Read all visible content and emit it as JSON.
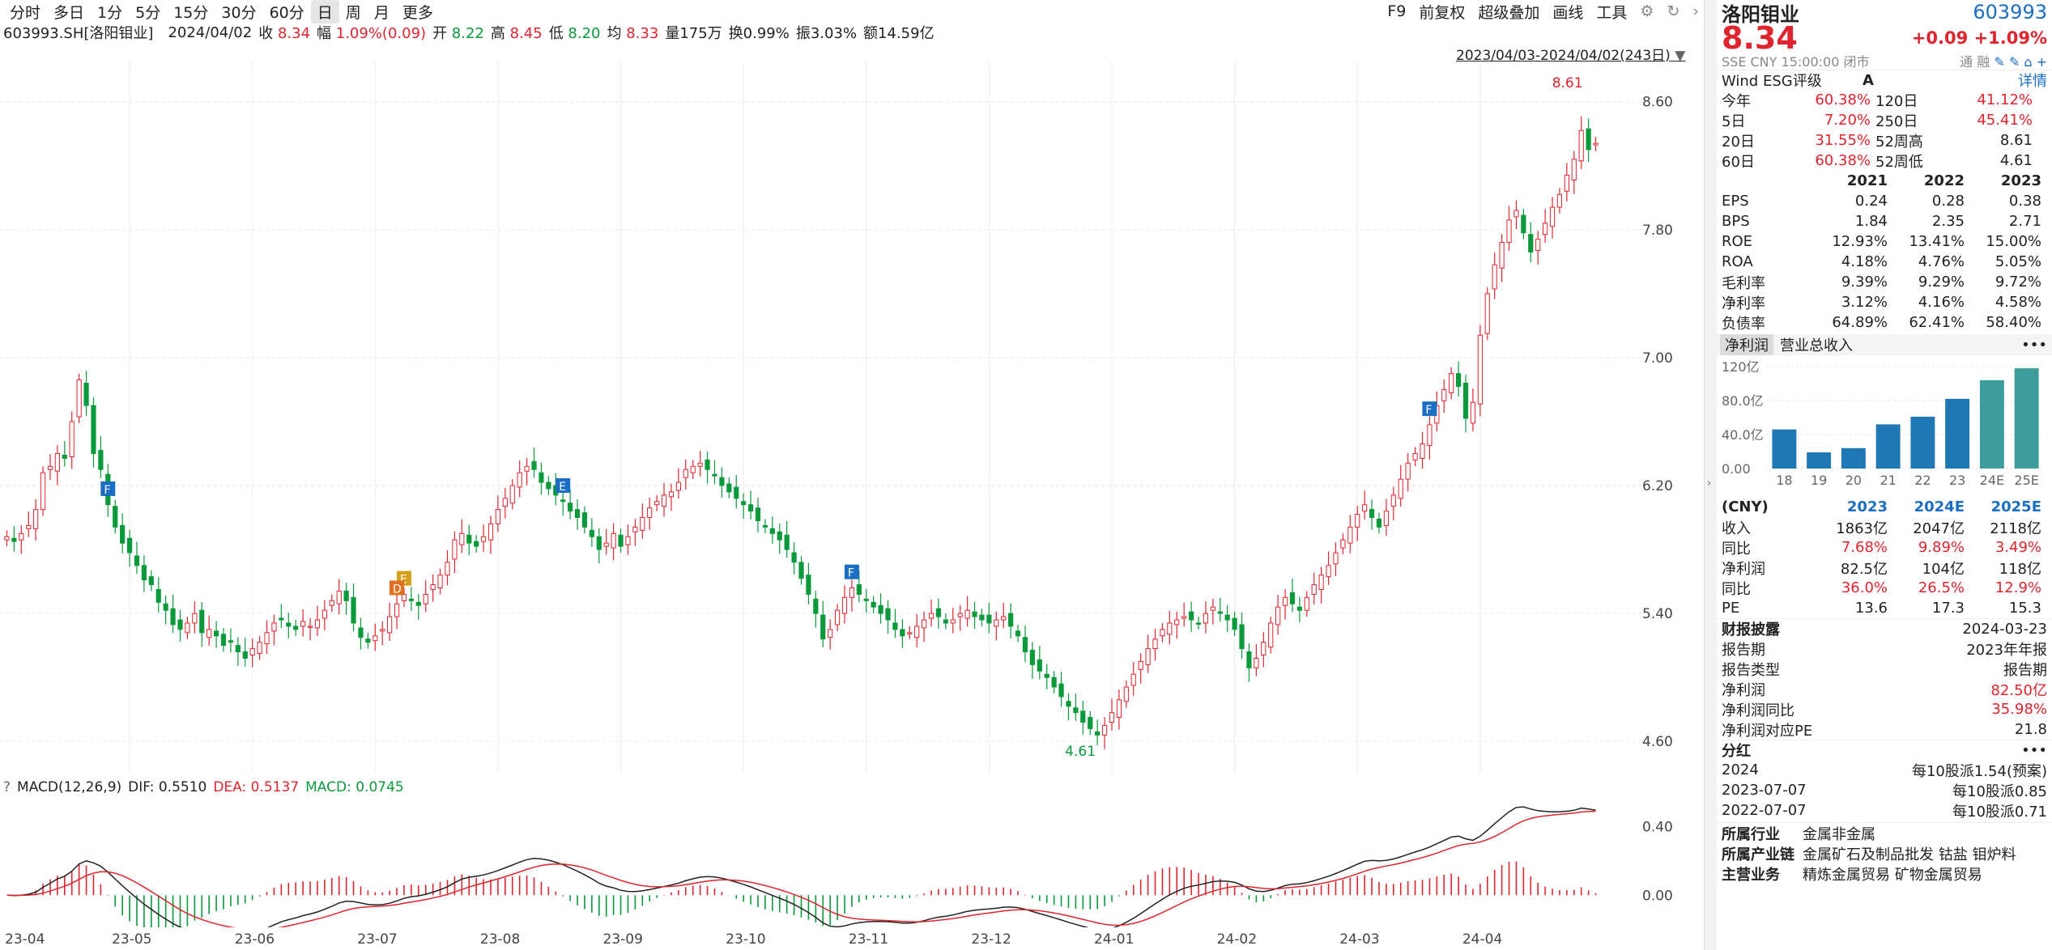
{
  "toolbar": {
    "tabs": [
      "分时",
      "多日",
      "1分",
      "5分",
      "15分",
      "30分",
      "60分",
      "日",
      "周",
      "月",
      "更多"
    ],
    "active": "日",
    "tools": [
      "F9",
      "前复权",
      "超级叠加",
      "画线",
      "工具"
    ]
  },
  "info": {
    "code": "603993.SH[洛阳钼业]",
    "date": "2024/04/02",
    "close_label": "收",
    "close": "8.34",
    "chg_label": "幅",
    "chg": "1.09%(0.09)",
    "open_label": "开",
    "open": "8.22",
    "high_label": "高",
    "high": "8.45",
    "low_label": "低",
    "low": "8.20",
    "avg_label": "均",
    "avg": "8.33",
    "vol_label": "量",
    "vol": "175万",
    "turn_label": "换",
    "turn": "0.99%",
    "amp_label": "振",
    "amp": "3.03%",
    "amt_label": "额",
    "amt": "14.59亿"
  },
  "range": "2023/04/03-2024/04/02(243日)",
  "macd": {
    "label": "MACD(12,26,9)",
    "dif_label": "DIF:",
    "dif": "0.5510",
    "dea_label": "DEA:",
    "dea": "0.5137",
    "macd_label": "MACD:",
    "macd": "0.0745"
  },
  "chart_data": [
    {
      "type": "candlestick",
      "y_ticks": [
        "8.60",
        "7.80",
        "7.00",
        "6.20",
        "5.40",
        "4.60"
      ],
      "ylim": [
        4.5,
        8.75
      ],
      "x_labels": [
        "23-04",
        "23-05",
        "23-06",
        "23-07",
        "23-08",
        "23-09",
        "23-10",
        "23-11",
        "23-12",
        "24-01",
        "24-02",
        "24-03",
        "24-04"
      ],
      "max_label": "8.61",
      "min_label": "4.61",
      "event_markers": [
        "F",
        "E",
        "D",
        "E",
        "F",
        "F"
      ],
      "close": [
        5.88,
        5.85,
        5.9,
        5.95,
        6.05,
        6.28,
        6.32,
        6.4,
        6.37,
        6.6,
        6.86,
        6.7,
        6.4,
        6.3,
        6.08,
        5.94,
        5.84,
        5.78,
        5.7,
        5.61,
        5.58,
        5.47,
        5.42,
        5.33,
        5.3,
        5.34,
        5.4,
        5.28,
        5.3,
        5.26,
        5.2,
        5.22,
        5.16,
        5.12,
        5.18,
        5.22,
        5.28,
        5.34,
        5.36,
        5.32,
        5.3,
        5.35,
        5.32,
        5.36,
        5.42,
        5.48,
        5.54,
        5.48,
        5.34,
        5.25,
        5.22,
        5.26,
        5.3,
        5.38,
        5.46,
        5.52,
        5.48,
        5.45,
        5.52,
        5.58,
        5.64,
        5.72,
        5.86,
        5.9,
        5.84,
        5.82,
        5.88,
        5.96,
        6.05,
        6.12,
        6.2,
        6.28,
        6.32,
        6.3,
        6.22,
        6.18,
        6.14,
        6.1,
        6.04,
        6.0,
        5.94,
        5.88,
        5.8,
        5.84,
        5.9,
        5.82,
        5.88,
        5.94,
        6.0,
        6.06,
        6.1,
        6.14,
        6.16,
        6.22,
        6.3,
        6.32,
        6.34,
        6.3,
        6.26,
        6.2,
        6.16,
        6.12,
        6.08,
        6.04,
        5.98,
        5.94,
        5.9,
        5.86,
        5.8,
        5.72,
        5.62,
        5.52,
        5.4,
        5.24,
        5.3,
        5.42,
        5.5,
        5.56,
        5.52,
        5.48,
        5.44,
        5.4,
        5.36,
        5.3,
        5.26,
        5.28,
        5.32,
        5.36,
        5.4,
        5.38,
        5.34,
        5.36,
        5.4,
        5.42,
        5.38,
        5.36,
        5.34,
        5.36,
        5.38,
        5.32,
        5.26,
        5.16,
        5.08,
        5.04,
        5.0,
        4.94,
        4.88,
        4.82,
        4.78,
        4.72,
        4.68,
        4.64,
        4.7,
        4.78,
        4.86,
        4.94,
        5.02,
        5.1,
        5.18,
        5.24,
        5.3,
        5.34,
        5.36,
        5.38,
        5.36,
        5.34,
        5.4,
        5.44,
        5.4,
        5.36,
        5.3,
        5.18,
        5.06,
        5.12,
        5.22,
        5.34,
        5.44,
        5.5,
        5.46,
        5.42,
        5.5,
        5.58,
        5.64,
        5.7,
        5.78,
        5.86,
        5.94,
        6.02,
        6.08,
        6.0,
        5.94,
        6.04,
        6.14,
        6.24,
        6.34,
        6.4,
        6.46,
        6.58,
        6.7,
        6.8,
        6.9,
        6.82,
        6.62,
        6.72,
        7.14,
        7.4,
        7.58,
        7.72,
        7.86,
        7.92,
        7.78,
        7.66,
        7.74,
        7.84,
        7.94,
        8.02,
        8.14,
        8.24,
        8.42,
        8.3,
        8.34
      ],
      "macd_ylim": [
        -0.15,
        0.55
      ],
      "macd_ticks": [
        "0.40",
        "0.00"
      ]
    }
  ],
  "right": {
    "name": "洛阳钼业",
    "code": "603993",
    "price": "8.34",
    "chg": "+0.09",
    "pct": "+1.09%",
    "sub": "SSE  CNY  15:00:00  闭市",
    "icons": [
      "通",
      "融"
    ],
    "esg_label": "Wind ESG评级",
    "esg": "A",
    "esg_link": "详情",
    "returns": [
      {
        "k1": "今年",
        "v1": "60.38%",
        "k2": "120日",
        "v2": "41.12%"
      },
      {
        "k1": "5日",
        "v1": "7.20%",
        "k2": "250日",
        "v2": "45.41%"
      },
      {
        "k1": "20日",
        "v1": "31.55%",
        "k2": "52周高",
        "v2": "8.61"
      },
      {
        "k1": "60日",
        "v1": "60.38%",
        "k2": "52周低",
        "v2": "4.61"
      }
    ],
    "fin_head": [
      "",
      "2021",
      "2022",
      "2023"
    ],
    "fin": [
      [
        "EPS",
        "0.24",
        "0.28",
        "0.38"
      ],
      [
        "BPS",
        "1.84",
        "2.35",
        "2.71"
      ],
      [
        "ROE",
        "12.93%",
        "13.41%",
        "15.00%"
      ],
      [
        "ROA",
        "4.18%",
        "4.76%",
        "5.05%"
      ],
      [
        "毛利率",
        "9.39%",
        "9.29%",
        "9.72%"
      ],
      [
        "净利率",
        "3.12%",
        "4.16%",
        "4.58%"
      ],
      [
        "负债率",
        "64.89%",
        "62.41%",
        "58.40%"
      ]
    ],
    "bar_tabs": [
      "净利润",
      "营业总收入"
    ],
    "bar_more": "•••",
    "bar_chart": {
      "type": "bar",
      "categories": [
        "18",
        "19",
        "20",
        "21",
        "22",
        "23",
        "24E",
        "25E"
      ],
      "values": [
        46,
        19,
        24,
        52,
        61,
        82,
        104,
        118
      ],
      "y_ticks": [
        "120亿",
        "80.0亿",
        "40.0亿",
        "0.00"
      ],
      "ylim": [
        0,
        120
      ]
    },
    "fc_head": [
      "(CNY)",
      "2023",
      "2024E",
      "2025E"
    ],
    "fc": [
      [
        "收入",
        "1863亿",
        "2047亿",
        "2118亿"
      ],
      [
        "同比",
        "7.68%",
        "9.89%",
        "3.49%"
      ],
      [
        "净利润",
        "82.5亿",
        "104亿",
        "118亿"
      ],
      [
        "同比",
        "36.0%",
        "26.5%",
        "12.9%"
      ],
      [
        "PE",
        "13.6",
        "17.3",
        "15.3"
      ]
    ],
    "report_title": "财报披露",
    "report_date": "2024-03-23",
    "report": [
      {
        "k": "报告期",
        "v": "2023年年报"
      },
      {
        "k": "报告类型",
        "v": "报告期"
      },
      {
        "k": "净利润",
        "v": "82.50亿"
      },
      {
        "k": "净利润同比",
        "v": "35.98%"
      },
      {
        "k": "净利润对应PE",
        "v": "21.8"
      }
    ],
    "div_title": "分红",
    "div_more": "•••",
    "div": [
      {
        "k": "2024",
        "v": "每10股派1.54(预案)"
      },
      {
        "k": "2023-07-07",
        "v": "每10股派0.85"
      },
      {
        "k": "2022-07-07",
        "v": "每10股派0.71"
      }
    ],
    "industry_label": "所属行业",
    "industry": "金属非金属",
    "chain_label": "所属产业链",
    "chain": "金属矿石及制品批发  钴盐  钼炉料",
    "biz_label": "主营业务",
    "biz": "精炼金属贸易  矿物金属贸易"
  }
}
